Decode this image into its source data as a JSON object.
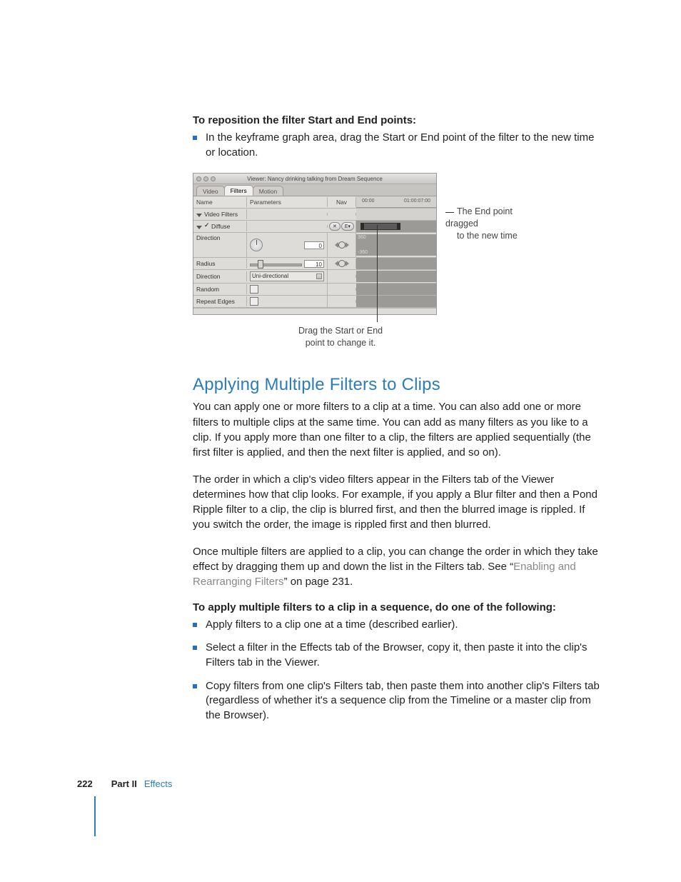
{
  "intro": {
    "task_head": "To reposition the filter Start and End points:",
    "bullet": "In the keyframe graph area, drag the Start or End point of the filter to the new time or location."
  },
  "viewer": {
    "title": "Viewer: Nancy drinking talking from Dream Sequence",
    "tabs": {
      "video": "Video",
      "filters": "Filters",
      "motion": "Motion"
    },
    "cols": {
      "name": "Name",
      "parameters": "Parameters",
      "nav": "Nav"
    },
    "ruler": {
      "left": "00:00",
      "right": "01:00:07:00"
    },
    "rows": {
      "video_filters": "Video Filters",
      "diffuse": "Diffuse",
      "direction": "Direction",
      "direction_val": "0",
      "direction_scale_top": "360",
      "direction_scale_bot": "-360",
      "radius": "Radius",
      "radius_val": "10",
      "direction_row2": "Direction",
      "direction_opt": "Uni-directional",
      "random": "Random",
      "repeat": "Repeat Edges"
    }
  },
  "captions": {
    "below1": "Drag the Start or End",
    "below2": "point to change it.",
    "right1": "The End point dragged",
    "right2": "to the new time"
  },
  "section": {
    "heading": "Applying Multiple Filters to Clips",
    "p1": "You can apply one or more filters to a clip at a time. You can also add one or more filters to multiple clips at the same time. You can add as many filters as you like to a clip. If you apply more than one filter to a clip, the filters are applied sequentially (the first filter is applied, and then the next filter is applied, and so on).",
    "p2": "The order in which a clip's video filters appear in the Filters tab of the Viewer determines how that clip looks. For example, if you apply a Blur filter and then a Pond Ripple filter to a clip, the clip is blurred first, and then the blurred image is rippled. If you switch the order, the image is rippled first and then blurred.",
    "p3_a": "Once multiple filters are applied to a clip, you can change the order in which they take effect by dragging them up and down the list in the Filters tab. See “",
    "p3_link": "Enabling and Rearranging Filters",
    "p3_b": "” on page 231.",
    "task2": "To apply multiple filters to a clip in a sequence, do one of the following:",
    "b1": "Apply filters to a clip one at a time (described earlier).",
    "b2": "Select a filter in the Effects tab of the Browser, copy it, then paste it into the clip's Filters tab in the Viewer.",
    "b3": "Copy filters from one clip's Filters tab, then paste them into another clip's Filters tab (regardless of whether it's a sequence clip from the Timeline or a master clip from the Browser)."
  },
  "footer": {
    "page": "222",
    "part": "Part II",
    "effects": "Effects"
  }
}
